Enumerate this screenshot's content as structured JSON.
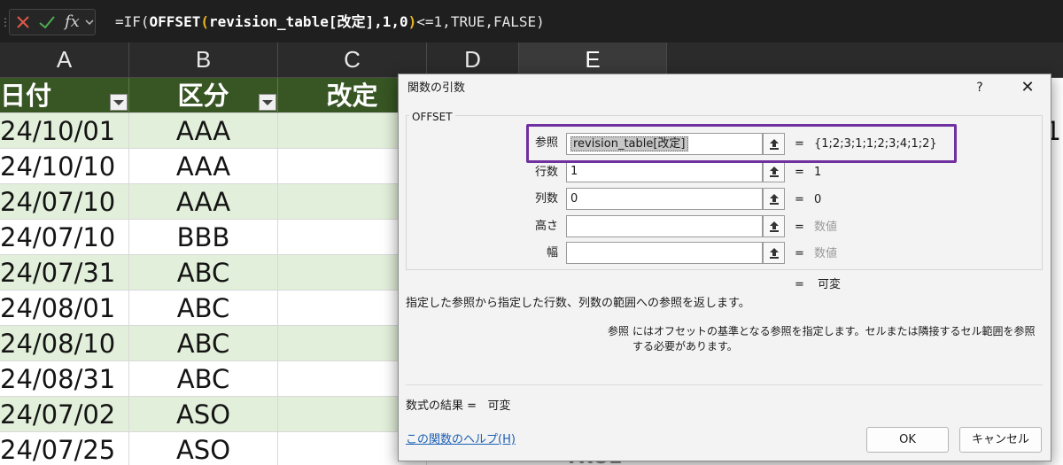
{
  "formula_bar": {
    "grip_icon": "⋮",
    "cancel_icon": "close-icon",
    "enter_icon": "check-icon",
    "fx_label": "fx",
    "formula_prefix": "=IF(",
    "formula_func": "OFFSET",
    "formula_open": "(",
    "formula_arg": "revision_table[改定],1,0",
    "formula_close": ")",
    "formula_suffix": "<=1,TRUE,FALSE)"
  },
  "columns": [
    "A",
    "B",
    "C",
    "D",
    "E"
  ],
  "table": {
    "header": {
      "a": "日付",
      "b": "区分",
      "c": "改定"
    },
    "rows": [
      {
        "a": "24/10/01",
        "b": "AAA"
      },
      {
        "a": "24/10/10",
        "b": "AAA"
      },
      {
        "a": "24/07/10",
        "b": "AAA"
      },
      {
        "a": "24/07/10",
        "b": "BBB"
      },
      {
        "a": "24/07/31",
        "b": "ABC"
      },
      {
        "a": "24/08/01",
        "b": "ABC"
      },
      {
        "a": "24/08/10",
        "b": "ABC"
      },
      {
        "a": "24/08/31",
        "b": "ABC"
      },
      {
        "a": "24/07/02",
        "b": "ASO"
      },
      {
        "a": "24/07/25",
        "b": "ASO"
      }
    ],
    "e1_partial": "1",
    "partial_bottom_text": "TRUE"
  },
  "dialog": {
    "title": "関数の引数",
    "help": "?",
    "close": "✕",
    "group_label": "OFFSET",
    "args": [
      {
        "label": "参照",
        "value": "revision_table[改定]",
        "result": "{1;2;3;1;1;2;3;4;1;2}"
      },
      {
        "label": "行数",
        "value": "1",
        "result": "1"
      },
      {
        "label": "列数",
        "value": "0",
        "result": "0"
      },
      {
        "label": "高さ",
        "value": "",
        "result": "数値"
      },
      {
        "label": "幅",
        "value": "",
        "result": "数値"
      }
    ],
    "equals": "=",
    "result": "可変",
    "description": "指定した参照から指定した行数、列数の範囲への参照を返します。",
    "param_name": "参照",
    "param_description": "にはオフセットの基準となる参照を指定します。セルまたは隣接するセル範囲を参照する必要があります。",
    "formula_result_label": "数式の結果 =",
    "formula_result_value": "可変",
    "help_link": "この関数のヘルプ(H)",
    "ok": "OK",
    "cancel": "キャンセル"
  },
  "colors": {
    "header_fill": "#375623",
    "band_fill": "#e2efda",
    "highlight_border": "#7030a0"
  }
}
